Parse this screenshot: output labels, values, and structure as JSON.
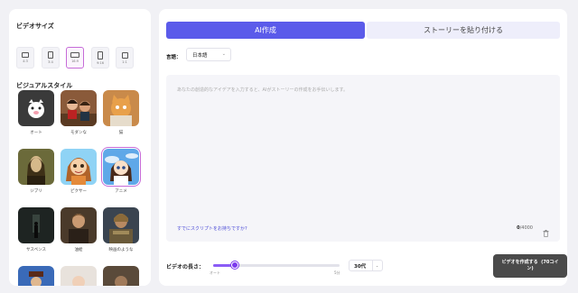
{
  "sidebar": {
    "video_size_title": "ビデオサイズ",
    "sizes": [
      {
        "label": "4:3"
      },
      {
        "label": "3:4"
      },
      {
        "label": "16:9"
      },
      {
        "label": "9:16"
      },
      {
        "label": "1:1"
      }
    ],
    "visual_style_title": "ビジュアルスタイル",
    "styles": [
      {
        "label": "オート"
      },
      {
        "label": "モダンな"
      },
      {
        "label": "猫"
      },
      {
        "label": "ジブリ"
      },
      {
        "label": "ピクサー"
      },
      {
        "label": "アニメ"
      },
      {
        "label": "サスペンス"
      },
      {
        "label": "油絵"
      },
      {
        "label": "映画のような"
      }
    ]
  },
  "tabs": {
    "ai_create": "AI作成",
    "paste_story": "ストーリーを貼り付ける"
  },
  "language": {
    "label": "言語：",
    "value": "日本語"
  },
  "prompt": {
    "placeholder": "あなたの創造的なアイデアを入力すると、AIがストーリーの作成をお手伝いします。",
    "script_link": "すでにスクリプトをお持ちですか?",
    "count": "0",
    "max": "/4000"
  },
  "video_length": {
    "label": "ビデオの長さ：",
    "min_label": "オート",
    "max_label": "5分",
    "value": "30代",
    "level_fraction": 0.17
  },
  "create_button": {
    "label": "ビデオを作成する",
    "cost": "(70コイン)"
  },
  "colors": {
    "accent": "#5b5bea",
    "selected_border": "#c66bd8",
    "slider": "#7c3aed",
    "button_dark": "#4a4a4a"
  }
}
